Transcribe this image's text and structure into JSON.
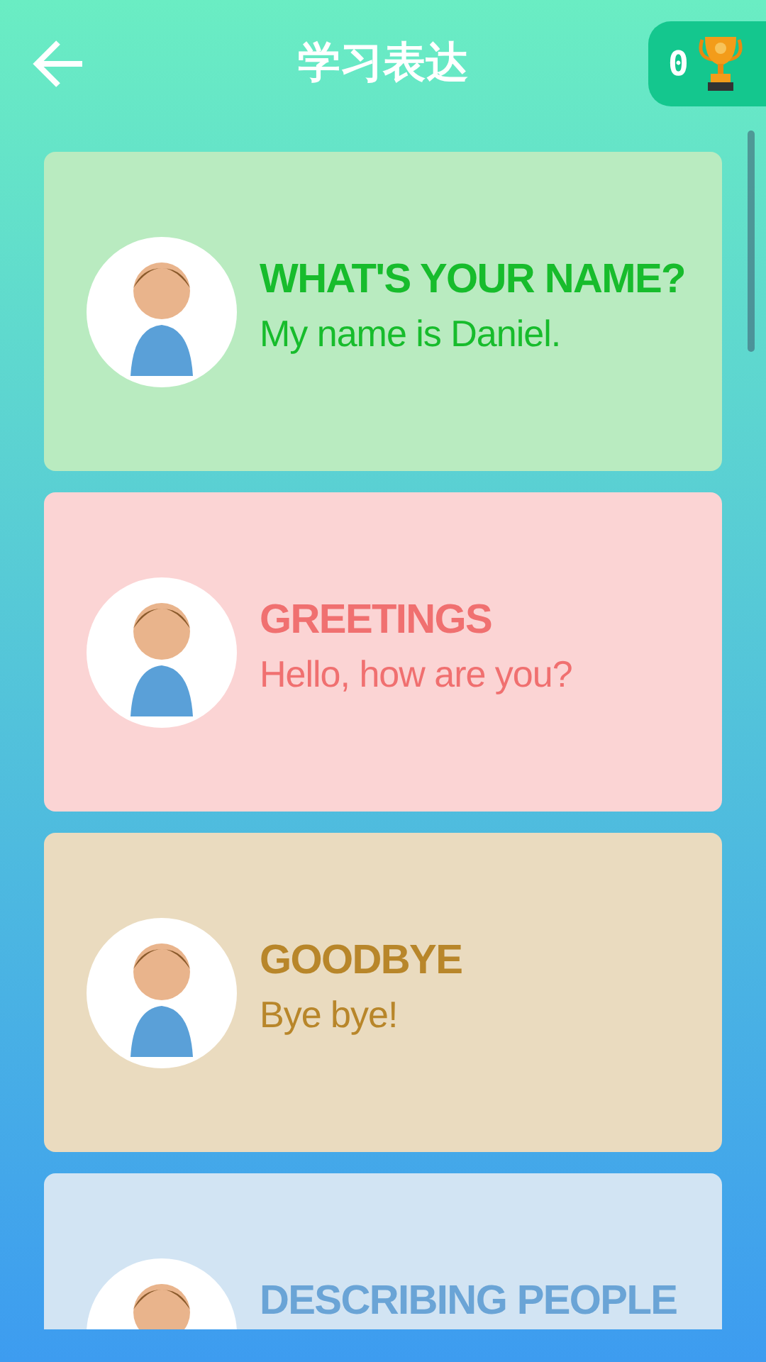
{
  "header": {
    "title": "学习表达",
    "score": "0"
  },
  "cards": [
    {
      "title": "WHAT'S YOUR NAME?",
      "subtitle": "My name is Daniel.",
      "color": "#17bc2c"
    },
    {
      "title": "GREETINGS",
      "subtitle": "Hello, how are you?",
      "color": "#f07070"
    },
    {
      "title": "GOODBYE",
      "subtitle": "Bye bye!",
      "color": "#b8862a"
    },
    {
      "title": "DESCRIBING PEOPLE",
      "color": "#6aa4d6"
    }
  ]
}
